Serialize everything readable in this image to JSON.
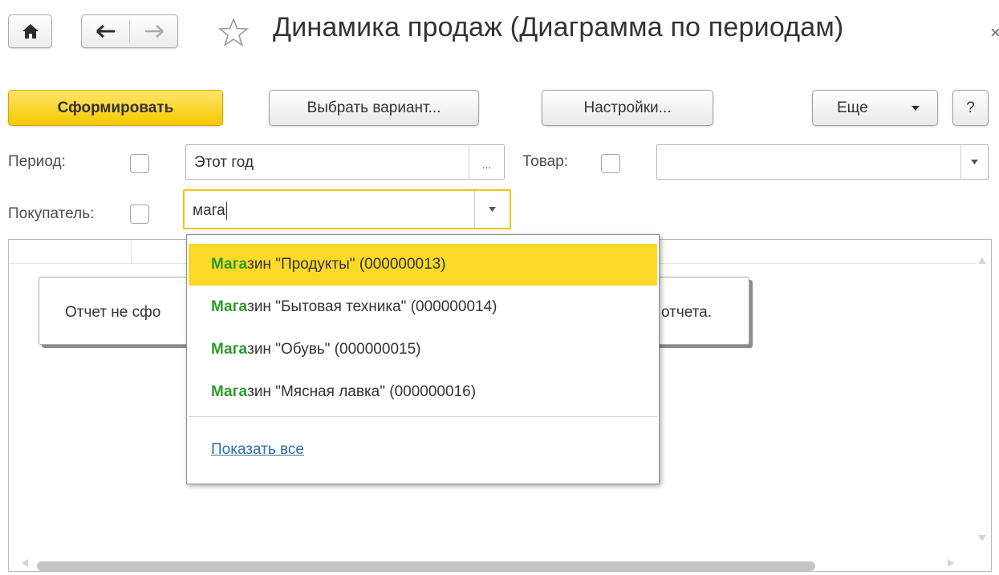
{
  "window": {
    "title": "Динамика продаж (Диаграмма по периодам)",
    "close_glyph": "×"
  },
  "nav": {
    "icons": [
      "home-icon",
      "back-arrow-icon",
      "forward-arrow-icon",
      "star-icon",
      "close-icon"
    ]
  },
  "toolbar": {
    "generate_label": "Сформировать",
    "choose_variant_label": "Выбрать вариант...",
    "settings_label": "Настройки...",
    "more_label": "Еще",
    "help_label": "?"
  },
  "filters": {
    "period": {
      "label": "Период:",
      "checked": false,
      "value": "Этот год",
      "button": "..."
    },
    "product": {
      "label": "Товар:",
      "checked": false,
      "value": ""
    },
    "buyer": {
      "label": "Покупатель:",
      "checked": false,
      "value": "мага"
    }
  },
  "report": {
    "message_left": "Отчет не сфо",
    "message_right": "отчета."
  },
  "dropdown": {
    "items": [
      {
        "match": "Мага",
        "rest": "зин \"Продукты\" (000000013)",
        "selected": true
      },
      {
        "match": "Мага",
        "rest": "зин \"Бытовая техника\" (000000014)",
        "selected": false
      },
      {
        "match": "Мага",
        "rest": "зин \"Обувь\" (000000015)",
        "selected": false
      },
      {
        "match": "Мага",
        "rest": "зин \"Мясная лавка\" (000000016)",
        "selected": false
      }
    ],
    "show_all_label": "Показать все"
  },
  "colors": {
    "accent_yellow": "#f6c800",
    "match_green": "#2d9a29",
    "link_blue": "#2e6ea6"
  }
}
